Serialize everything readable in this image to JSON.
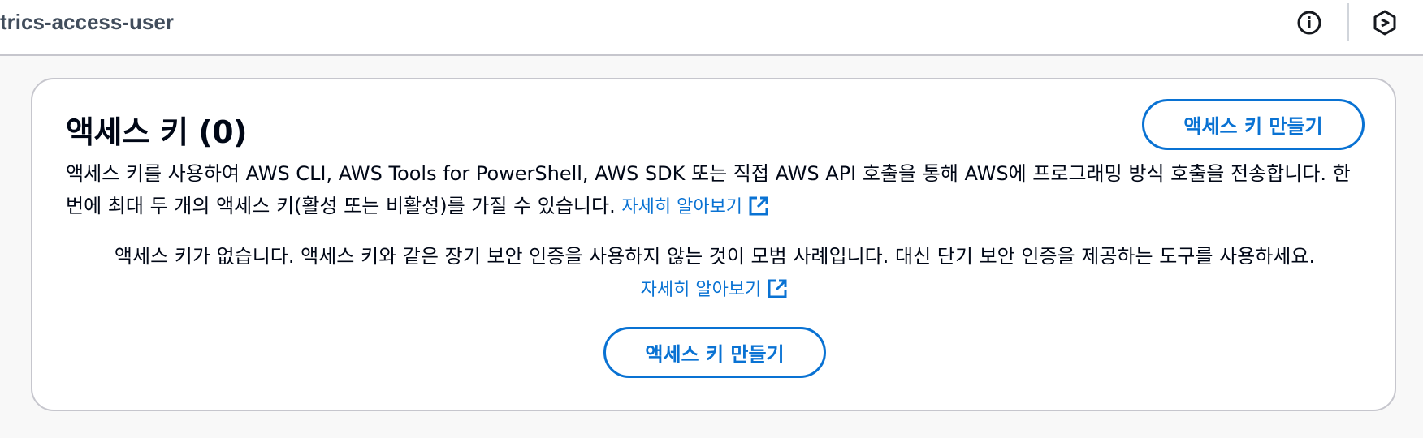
{
  "header": {
    "title": "trics-access-user",
    "info_icon": "info-icon",
    "logo_icon": "cloudshell-logo-icon"
  },
  "access_keys": {
    "title": "액세스 키 (0)",
    "create_button_label": "액세스 키 만들기",
    "description": "액세스 키를 사용하여 AWS CLI, AWS Tools for PowerShell, AWS SDK 또는 직접 AWS API 호출을 통해 AWS에 프로그래밍 방식 호출을 전송합니다. 한 번에 최대 두 개의 액세스 키(활성 또는 비활성)를 가질 수 있습니다.",
    "learn_more_label": "자세히 알아보기",
    "empty_message": "액세스 키가 없습니다. 액세스 키와 같은 장기 보안 인증을 사용하지 않는 것이 모범 사례입니다. 대신 단기 보안 인증을 제공하는 도구를 사용하세요.",
    "empty_learn_more_label": "자세히 알아보기",
    "empty_create_button_label": "액세스 키 만들기"
  },
  "colors": {
    "link": "#0972d3",
    "border": "#c6c6cd",
    "text": "#000716"
  }
}
